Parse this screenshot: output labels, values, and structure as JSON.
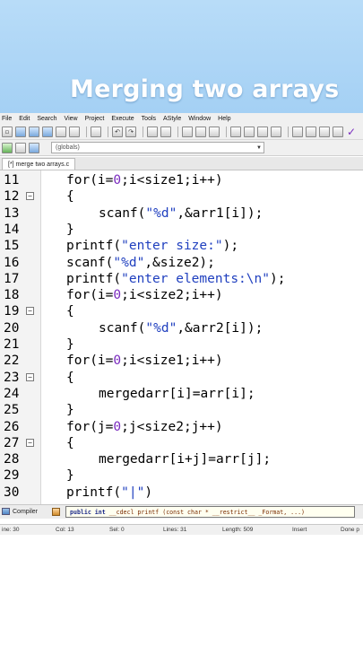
{
  "banner": {
    "title": "Merging two arrays"
  },
  "menu": [
    "File",
    "Edit",
    "Search",
    "View",
    "Project",
    "Execute",
    "Tools",
    "AStyle",
    "Window",
    "Help"
  ],
  "scope_select": {
    "value": "(globals)"
  },
  "editor_tab": {
    "label": "[*] merge two arrays.c"
  },
  "code_lines": [
    {
      "no": "11",
      "fold": false,
      "indent": 0,
      "parts": [
        [
          "t",
          "for(i="
        ],
        [
          "n",
          "0"
        ],
        [
          "t",
          ";i<size1;i++)"
        ]
      ]
    },
    {
      "no": "12",
      "fold": true,
      "indent": 0,
      "parts": [
        [
          "t",
          "{"
        ]
      ]
    },
    {
      "no": "13",
      "fold": false,
      "indent": 1,
      "parts": [
        [
          "t",
          "scanf("
        ],
        [
          "s",
          "\"%d\""
        ],
        [
          "t",
          ",&arr1[i]);"
        ]
      ]
    },
    {
      "no": "14",
      "fold": false,
      "indent": 0,
      "parts": [
        [
          "t",
          "}"
        ]
      ]
    },
    {
      "no": "15",
      "fold": false,
      "indent": 0,
      "parts": [
        [
          "t",
          "printf("
        ],
        [
          "s",
          "\"enter size:\""
        ],
        [
          "t",
          ");"
        ]
      ]
    },
    {
      "no": "16",
      "fold": false,
      "indent": 0,
      "parts": [
        [
          "t",
          "scanf("
        ],
        [
          "s",
          "\"%d\""
        ],
        [
          "t",
          ",&size2);"
        ]
      ]
    },
    {
      "no": "17",
      "fold": false,
      "indent": 0,
      "parts": [
        [
          "t",
          "printf("
        ],
        [
          "s",
          "\"enter elements:\\n\""
        ],
        [
          "t",
          ");"
        ]
      ]
    },
    {
      "no": "18",
      "fold": false,
      "indent": 0,
      "parts": [
        [
          "t",
          "for(i="
        ],
        [
          "n",
          "0"
        ],
        [
          "t",
          ";i<size2;i++)"
        ]
      ]
    },
    {
      "no": "19",
      "fold": true,
      "indent": 0,
      "parts": [
        [
          "t",
          "{"
        ]
      ]
    },
    {
      "no": "20",
      "fold": false,
      "indent": 1,
      "parts": [
        [
          "t",
          "scanf("
        ],
        [
          "s",
          "\"%d\""
        ],
        [
          "t",
          ",&arr2[i]);"
        ]
      ]
    },
    {
      "no": "21",
      "fold": false,
      "indent": 0,
      "parts": [
        [
          "t",
          "}"
        ]
      ]
    },
    {
      "no": "22",
      "fold": false,
      "indent": 0,
      "parts": [
        [
          "t",
          "for(i="
        ],
        [
          "n",
          "0"
        ],
        [
          "t",
          ";i<size1;i++)"
        ]
      ]
    },
    {
      "no": "23",
      "fold": true,
      "indent": 0,
      "parts": [
        [
          "t",
          "{"
        ]
      ]
    },
    {
      "no": "24",
      "fold": false,
      "indent": 1,
      "parts": [
        [
          "t",
          "mergedarr[i]=arr[i];"
        ]
      ]
    },
    {
      "no": "25",
      "fold": false,
      "indent": 0,
      "parts": [
        [
          "t",
          "}"
        ]
      ]
    },
    {
      "no": "26",
      "fold": false,
      "indent": 0,
      "parts": [
        [
          "t",
          "for(j="
        ],
        [
          "n",
          "0"
        ],
        [
          "t",
          ";j<size2;j++)"
        ]
      ]
    },
    {
      "no": "27",
      "fold": true,
      "indent": 0,
      "parts": [
        [
          "t",
          "{"
        ]
      ]
    },
    {
      "no": "28",
      "fold": false,
      "indent": 1,
      "parts": [
        [
          "t",
          "mergedarr[i+j]=arr[j];"
        ]
      ]
    },
    {
      "no": "29",
      "fold": false,
      "indent": 0,
      "parts": [
        [
          "t",
          "}"
        ]
      ]
    },
    {
      "no": "30",
      "fold": false,
      "indent": 0,
      "parts": [
        [
          "t",
          "printf("
        ],
        [
          "s",
          "\"|\""
        ],
        [
          "t",
          ")"
        ]
      ]
    }
  ],
  "bottom": {
    "compiler_tab": "Compiler",
    "tooltip_keyword": "public int",
    "tooltip_rest": " __cdecl printf (const char * __restrict__ _Format, ...)"
  },
  "status": {
    "line": "ine: 30",
    "col": "Col: 13",
    "sel": "Sel: 0",
    "lines": "Lines: 31",
    "length": "Length: 509",
    "mode": "Insert",
    "state": "Done p"
  }
}
